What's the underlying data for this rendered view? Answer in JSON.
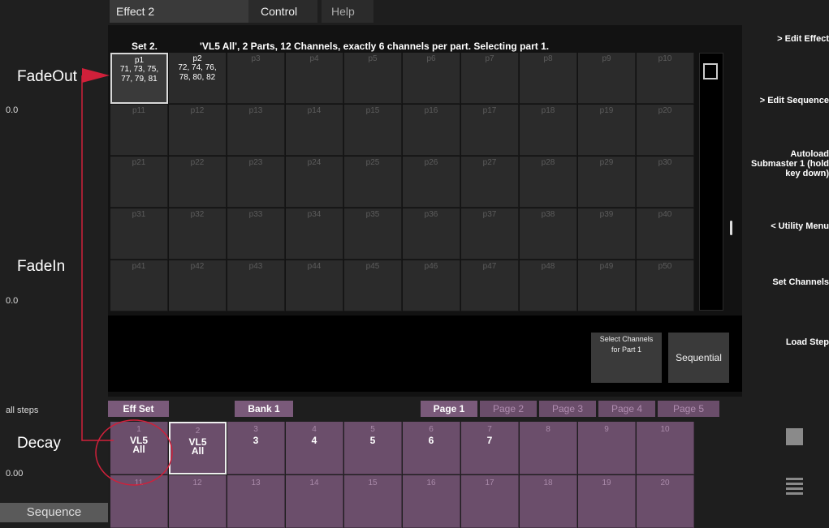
{
  "tabs": [
    "Effect 2",
    "Control",
    "Help"
  ],
  "left": {
    "fadeout_label": "FadeOut",
    "fadeout_value": "0.0",
    "fadein_label": "FadeIn",
    "fadein_value": "0.0",
    "steps_label": "all steps",
    "decay_label": "Decay",
    "decay_value": "0.00",
    "sequence_button": "Sequence"
  },
  "header": {
    "set": "Set 2.",
    "description": "'VL5 All', 2 Parts, 12 Channels, exactly 6 channels per part.  Selecting part 1."
  },
  "parts": [
    {
      "label": "p1",
      "channels": [
        "71, 73, 75,",
        "77, 79, 81"
      ]
    },
    {
      "label": "p2",
      "channels": [
        "72, 74, 76,",
        "78, 80, 82"
      ]
    },
    {
      "label": "p3"
    },
    {
      "label": "p4"
    },
    {
      "label": "p5"
    },
    {
      "label": "p6"
    },
    {
      "label": "p7"
    },
    {
      "label": "p8"
    },
    {
      "label": "p9"
    },
    {
      "label": "p10"
    },
    {
      "label": "p11"
    },
    {
      "label": "p12"
    },
    {
      "label": "p13"
    },
    {
      "label": "p14"
    },
    {
      "label": "p15"
    },
    {
      "label": "p16"
    },
    {
      "label": "p17"
    },
    {
      "label": "p18"
    },
    {
      "label": "p19"
    },
    {
      "label": "p20"
    },
    {
      "label": "p21"
    },
    {
      "label": "p22"
    },
    {
      "label": "p23"
    },
    {
      "label": "p24"
    },
    {
      "label": "p25"
    },
    {
      "label": "p26"
    },
    {
      "label": "p27"
    },
    {
      "label": "p28"
    },
    {
      "label": "p29"
    },
    {
      "label": "p30"
    },
    {
      "label": "p31"
    },
    {
      "label": "p32"
    },
    {
      "label": "p33"
    },
    {
      "label": "p34"
    },
    {
      "label": "p35"
    },
    {
      "label": "p36"
    },
    {
      "label": "p37"
    },
    {
      "label": "p38"
    },
    {
      "label": "p39"
    },
    {
      "label": "p40"
    },
    {
      "label": "p41"
    },
    {
      "label": "p42"
    },
    {
      "label": "p43"
    },
    {
      "label": "p44"
    },
    {
      "label": "p45"
    },
    {
      "label": "p46"
    },
    {
      "label": "p47"
    },
    {
      "label": "p48"
    },
    {
      "label": "p49"
    },
    {
      "label": "p50"
    }
  ],
  "buttons": {
    "select_channels": "Select Channels for Part 1",
    "sequential": "Sequential"
  },
  "right_menu": [
    "> Edit Effect",
    "> Edit Sequence",
    "Autoload Submaster 1 (hold key down)",
    "< Utility Menu",
    "Set Channels",
    "Load Step"
  ],
  "bottom_tabs": [
    "Eff Set",
    "Bank 1",
    "Page 1",
    "Page 2",
    "Page 3",
    "Page 4",
    "Page 5"
  ],
  "sets": [
    {
      "n": "1",
      "name": "VL5 All"
    },
    {
      "n": "2",
      "name": "VL5 All"
    },
    {
      "n": "3",
      "name": "3"
    },
    {
      "n": "4",
      "name": "4"
    },
    {
      "n": "5",
      "name": "5"
    },
    {
      "n": "6",
      "name": "6"
    },
    {
      "n": "7",
      "name": "7"
    },
    {
      "n": "8",
      "name": ""
    },
    {
      "n": "9",
      "name": ""
    },
    {
      "n": "10",
      "name": ""
    },
    {
      "n": "11",
      "name": ""
    },
    {
      "n": "12",
      "name": ""
    },
    {
      "n": "13",
      "name": ""
    },
    {
      "n": "14",
      "name": ""
    },
    {
      "n": "15",
      "name": ""
    },
    {
      "n": "16",
      "name": ""
    },
    {
      "n": "17",
      "name": ""
    },
    {
      "n": "18",
      "name": ""
    },
    {
      "n": "19",
      "name": ""
    },
    {
      "n": "20",
      "name": ""
    }
  ],
  "right_icons": [
    "stop-icon",
    "menu-icon"
  ],
  "colors": {
    "accent_set": "#6b4e6b",
    "annotation": "#d0203a"
  }
}
